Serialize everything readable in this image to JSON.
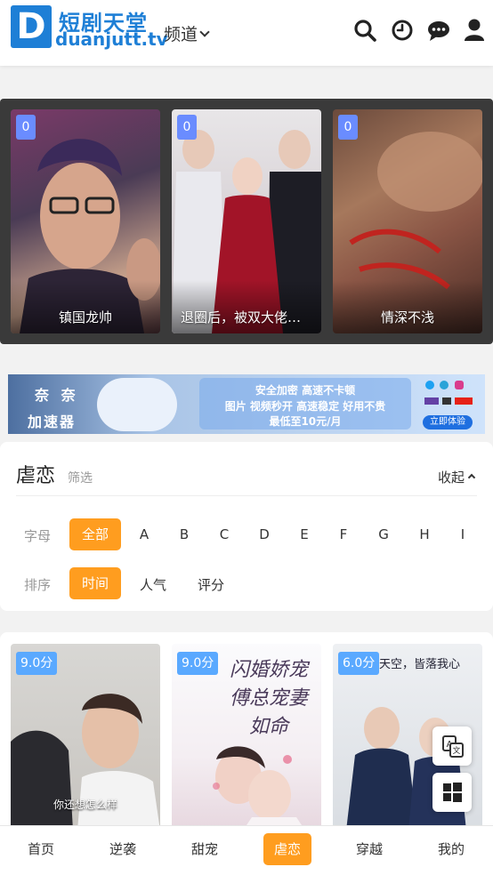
{
  "header": {
    "logo_letter": "D",
    "logo_cn": "短剧天堂",
    "logo_en": "duanjutt.tv",
    "channel_label": "频道",
    "icons": [
      "search-icon",
      "history-icon",
      "chat-icon",
      "user-icon"
    ]
  },
  "featured": [
    {
      "badge": "0",
      "title": "镇国龙帅"
    },
    {
      "badge": "0",
      "title": "退圈后，被双大佬宠..."
    },
    {
      "badge": "0",
      "title": "情深不浅"
    }
  ],
  "banner": {
    "brand_line1": "奈 奈",
    "brand_line2": "加速器",
    "tagline1": "安全加密 高速不卡顿",
    "tagline2": "图片 视频秒开 高速稳定 好用不贵",
    "tagline3": "最低至10元/月",
    "cta": "立即体验"
  },
  "filter": {
    "title": "虐恋",
    "subtitle": "筛选",
    "collapse_label": "收起",
    "letter_label": "字母",
    "letters": [
      "全部",
      "A",
      "B",
      "C",
      "D",
      "E",
      "F",
      "G",
      "H",
      "I"
    ],
    "letter_active": "全部",
    "sort_label": "排序",
    "sorts": [
      "时间",
      "人气",
      "评分"
    ],
    "sort_active": "时间"
  },
  "grid": [
    {
      "score": "9.0分",
      "caption": "你还想怎么样"
    },
    {
      "score": "9.0分",
      "caption": "闪婚娇宠 傅总宠妻如命"
    },
    {
      "score": "6.0分",
      "caption": "天空，皆落我心"
    }
  ],
  "fabs": [
    "translate-icon",
    "windows-icon"
  ],
  "bottom_nav": [
    "首页",
    "逆袭",
    "甜宠",
    "虐恋",
    "穿越",
    "我的"
  ],
  "bottom_nav_active": "虐恋",
  "colors": {
    "brand_blue": "#1e7fd6",
    "accent_orange": "#ff9d1f",
    "badge_blue": "#6a8cff",
    "score_blue": "#5aa9ff"
  }
}
